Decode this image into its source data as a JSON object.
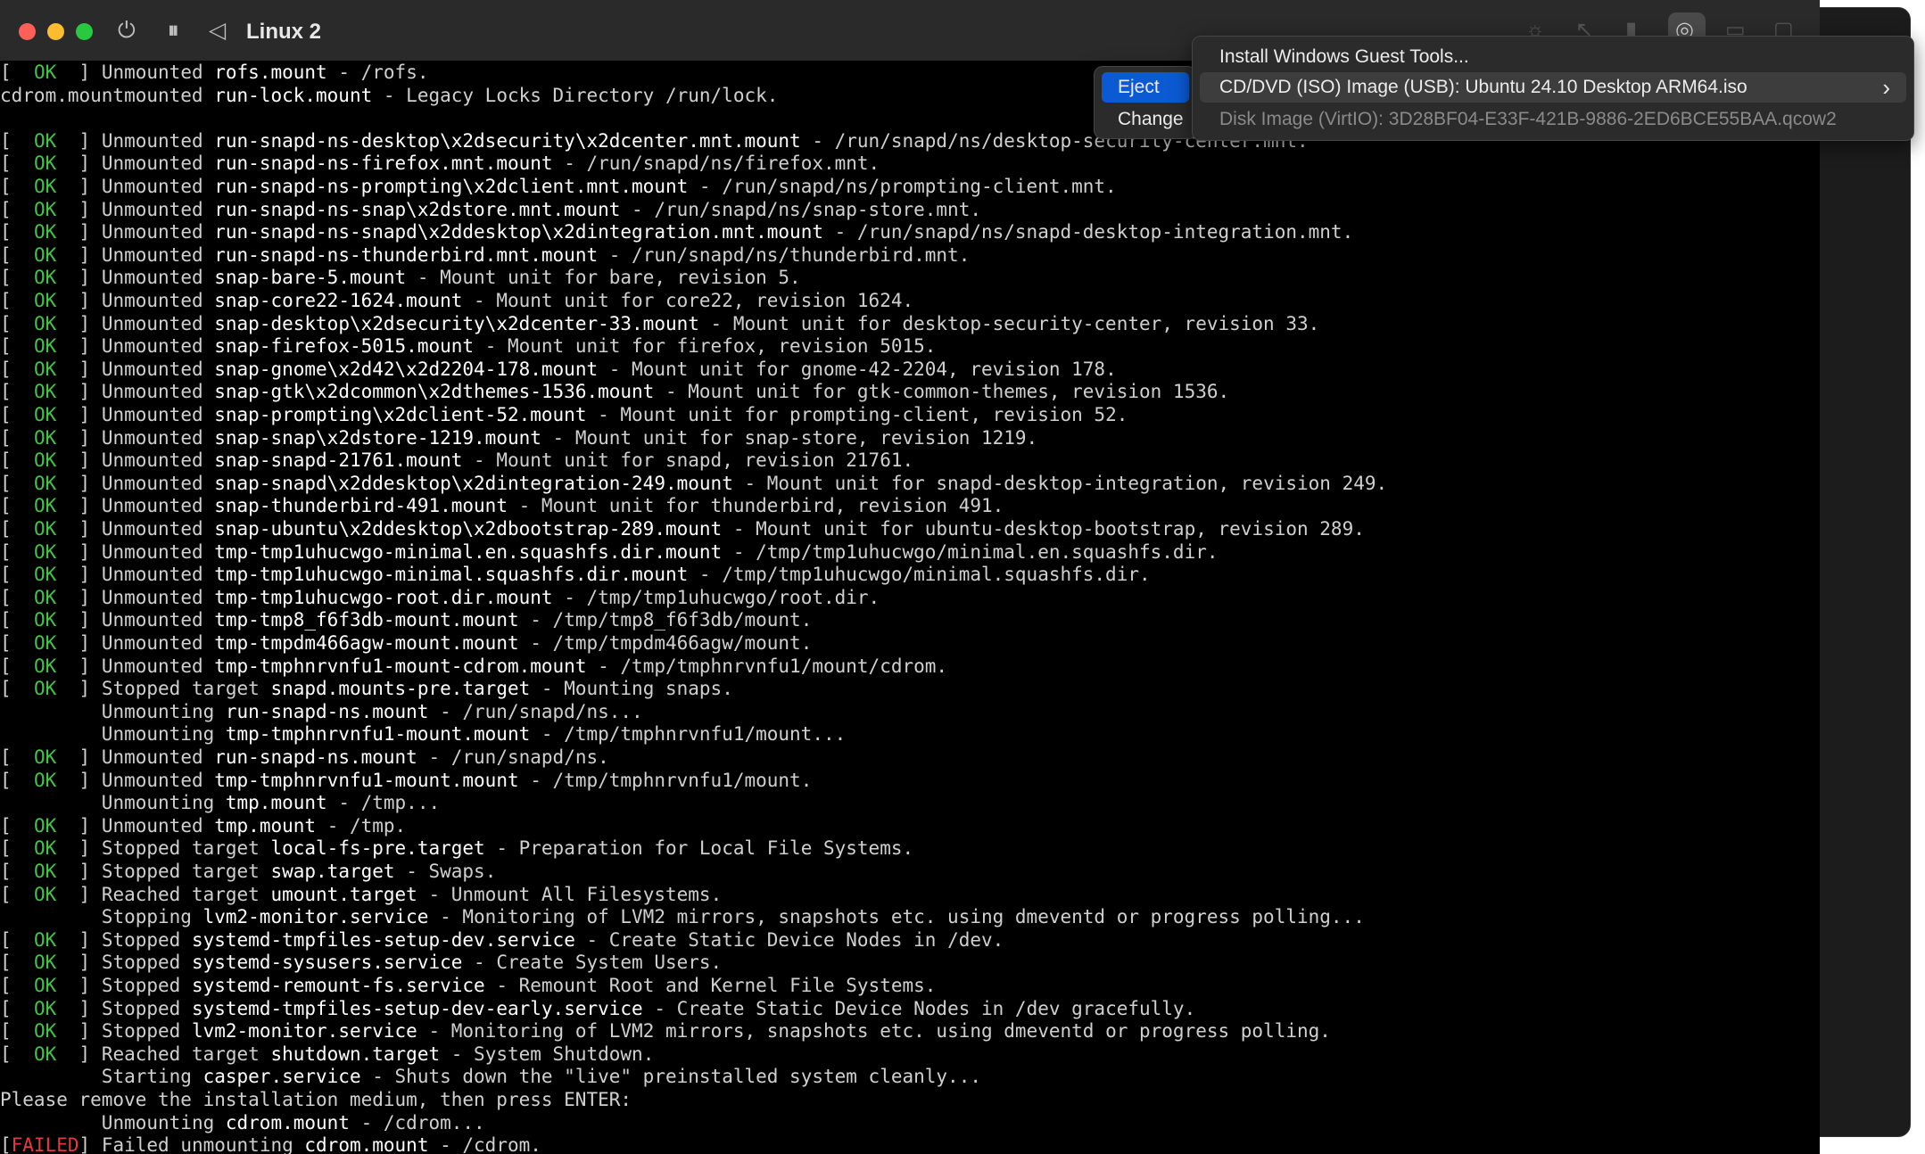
{
  "window": {
    "title": "Linux 2",
    "controls": [
      "power-icon",
      "pause-icon",
      "back-icon"
    ],
    "toolbar_icons": [
      "brightness-icon",
      "cursor-icon",
      "usb-icon",
      "cd-icon",
      "folder-icon",
      "window-icon"
    ]
  },
  "eject_menu": {
    "items": [
      {
        "label": "Eject",
        "selected": true
      },
      {
        "label": "Change",
        "selected": false
      }
    ]
  },
  "device_menu": {
    "items": [
      {
        "label": "Install Windows Guest Tools...",
        "disabled": false
      },
      {
        "label": "CD/DVD (ISO) Image (USB): Ubuntu 24.10 Desktop ARM64.iso",
        "disabled": false,
        "highlighted": true,
        "submenu": true
      },
      {
        "label": "Disk Image (VirtIO): 3D28BF04-E33F-421B-9886-2ED6BCE55BAA.qcow2",
        "disabled": true
      }
    ]
  },
  "terminal": {
    "lines": [
      {
        "status": "OK",
        "verb": "Unmounted",
        "unit": "rofs.mount",
        "desc": " - /rofs."
      },
      {
        "status": "",
        "verb": "cdrom.mountmounted",
        "unit": "run-lock.mount",
        "desc": " - Legacy Locks Directory /run/lock.",
        "raw": true
      },
      {
        "status": "",
        "verb": "",
        "unit": "",
        "desc": "",
        "blank": true
      },
      {
        "status": "OK",
        "verb": "Unmounted",
        "unit": "run-snapd-ns-desktop\\x2dsecurity\\x2dcenter.mnt.mount",
        "desc": " - /run/snapd/ns/desktop-security-center.mnt."
      },
      {
        "status": "OK",
        "verb": "Unmounted",
        "unit": "run-snapd-ns-firefox.mnt.mount",
        "desc": " - /run/snapd/ns/firefox.mnt."
      },
      {
        "status": "OK",
        "verb": "Unmounted",
        "unit": "run-snapd-ns-prompting\\x2dclient.mnt.mount",
        "desc": " - /run/snapd/ns/prompting-client.mnt."
      },
      {
        "status": "OK",
        "verb": "Unmounted",
        "unit": "run-snapd-ns-snap\\x2dstore.mnt.mount",
        "desc": " - /run/snapd/ns/snap-store.mnt."
      },
      {
        "status": "OK",
        "verb": "Unmounted",
        "unit": "run-snapd-ns-snapd\\x2ddesktop\\x2dintegration.mnt.mount",
        "desc": " - /run/snapd/ns/snapd-desktop-integration.mnt."
      },
      {
        "status": "OK",
        "verb": "Unmounted",
        "unit": "run-snapd-ns-thunderbird.mnt.mount",
        "desc": " - /run/snapd/ns/thunderbird.mnt."
      },
      {
        "status": "OK",
        "verb": "Unmounted",
        "unit": "snap-bare-5.mount",
        "desc": " - Mount unit for bare, revision 5."
      },
      {
        "status": "OK",
        "verb": "Unmounted",
        "unit": "snap-core22-1624.mount",
        "desc": " - Mount unit for core22, revision 1624."
      },
      {
        "status": "OK",
        "verb": "Unmounted",
        "unit": "snap-desktop\\x2dsecurity\\x2dcenter-33.mount",
        "desc": " - Mount unit for desktop-security-center, revision 33."
      },
      {
        "status": "OK",
        "verb": "Unmounted",
        "unit": "snap-firefox-5015.mount",
        "desc": " - Mount unit for firefox, revision 5015."
      },
      {
        "status": "OK",
        "verb": "Unmounted",
        "unit": "snap-gnome\\x2d42\\x2d2204-178.mount",
        "desc": " - Mount unit for gnome-42-2204, revision 178."
      },
      {
        "status": "OK",
        "verb": "Unmounted",
        "unit": "snap-gtk\\x2dcommon\\x2dthemes-1536.mount",
        "desc": " - Mount unit for gtk-common-themes, revision 1536."
      },
      {
        "status": "OK",
        "verb": "Unmounted",
        "unit": "snap-prompting\\x2dclient-52.mount",
        "desc": " - Mount unit for prompting-client, revision 52."
      },
      {
        "status": "OK",
        "verb": "Unmounted",
        "unit": "snap-snap\\x2dstore-1219.mount",
        "desc": " - Mount unit for snap-store, revision 1219."
      },
      {
        "status": "OK",
        "verb": "Unmounted",
        "unit": "snap-snapd-21761.mount",
        "desc": " - Mount unit for snapd, revision 21761."
      },
      {
        "status": "OK",
        "verb": "Unmounted",
        "unit": "snap-snapd\\x2ddesktop\\x2dintegration-249.mount",
        "desc": " - Mount unit for snapd-desktop-integration, revision 249."
      },
      {
        "status": "OK",
        "verb": "Unmounted",
        "unit": "snap-thunderbird-491.mount",
        "desc": " - Mount unit for thunderbird, revision 491."
      },
      {
        "status": "OK",
        "verb": "Unmounted",
        "unit": "snap-ubuntu\\x2ddesktop\\x2dbootstrap-289.mount",
        "desc": " - Mount unit for ubuntu-desktop-bootstrap, revision 289."
      },
      {
        "status": "OK",
        "verb": "Unmounted",
        "unit": "tmp-tmp1uhucwgo-minimal.en.squashfs.dir.mount",
        "desc": " - /tmp/tmp1uhucwgo/minimal.en.squashfs.dir."
      },
      {
        "status": "OK",
        "verb": "Unmounted",
        "unit": "tmp-tmp1uhucwgo-minimal.squashfs.dir.mount",
        "desc": " - /tmp/tmp1uhucwgo/minimal.squashfs.dir."
      },
      {
        "status": "OK",
        "verb": "Unmounted",
        "unit": "tmp-tmp1uhucwgo-root.dir.mount",
        "desc": " - /tmp/tmp1uhucwgo/root.dir."
      },
      {
        "status": "OK",
        "verb": "Unmounted",
        "unit": "tmp-tmp8_f6f3db-mount.mount",
        "desc": " - /tmp/tmp8_f6f3db/mount."
      },
      {
        "status": "OK",
        "verb": "Unmounted",
        "unit": "tmp-tmpdm466agw-mount.mount",
        "desc": " - /tmp/tmpdm466agw/mount."
      },
      {
        "status": "OK",
        "verb": "Unmounted",
        "unit": "tmp-tmphnrvnfu1-mount-cdrom.mount",
        "desc": " - /tmp/tmphnrvnfu1/mount/cdrom."
      },
      {
        "status": "OK",
        "verb": "Stopped target",
        "unit": "snapd.mounts-pre.target",
        "desc": " - Mounting snaps."
      },
      {
        "status": "",
        "verb": "Unmounting",
        "unit": "run-snapd-ns.mount",
        "desc": " - /run/snapd/ns..."
      },
      {
        "status": "",
        "verb": "Unmounting",
        "unit": "tmp-tmphnrvnfu1-mount.mount",
        "desc": " - /tmp/tmphnrvnfu1/mount..."
      },
      {
        "status": "OK",
        "verb": "Unmounted",
        "unit": "run-snapd-ns.mount",
        "desc": " - /run/snapd/ns."
      },
      {
        "status": "OK",
        "verb": "Unmounted",
        "unit": "tmp-tmphnrvnfu1-mount.mount",
        "desc": " - /tmp/tmphnrvnfu1/mount."
      },
      {
        "status": "",
        "verb": "Unmounting",
        "unit": "tmp.mount",
        "desc": " - /tmp..."
      },
      {
        "status": "OK",
        "verb": "Unmounted",
        "unit": "tmp.mount",
        "desc": " - /tmp."
      },
      {
        "status": "OK",
        "verb": "Stopped target",
        "unit": "local-fs-pre.target",
        "desc": " - Preparation for Local File Systems."
      },
      {
        "status": "OK",
        "verb": "Stopped target",
        "unit": "swap.target",
        "desc": " - Swaps."
      },
      {
        "status": "OK",
        "verb": "Reached target",
        "unit": "umount.target",
        "desc": " - Unmount All Filesystems."
      },
      {
        "status": "",
        "verb": "Stopping",
        "unit": "lvm2-monitor.service",
        "desc": " - Monitoring of LVM2 mirrors, snapshots etc. using dmeventd or progress polling..."
      },
      {
        "status": "OK",
        "verb": "Stopped",
        "unit": "systemd-tmpfiles-setup-dev.service",
        "desc": " - Create Static Device Nodes in /dev."
      },
      {
        "status": "OK",
        "verb": "Stopped",
        "unit": "systemd-sysusers.service",
        "desc": " - Create System Users."
      },
      {
        "status": "OK",
        "verb": "Stopped",
        "unit": "systemd-remount-fs.service",
        "desc": " - Remount Root and Kernel File Systems."
      },
      {
        "status": "OK",
        "verb": "Stopped",
        "unit": "systemd-tmpfiles-setup-dev-early.service",
        "desc": " - Create Static Device Nodes in /dev gracefully."
      },
      {
        "status": "OK",
        "verb": "Stopped",
        "unit": "lvm2-monitor.service",
        "desc": " - Monitoring of LVM2 mirrors, snapshots etc. using dmeventd or progress polling."
      },
      {
        "status": "OK",
        "verb": "Reached target",
        "unit": "shutdown.target",
        "desc": " - System Shutdown."
      },
      {
        "status": "",
        "verb": "Starting",
        "unit": "casper.service",
        "desc": " - Shuts down the \"live\" preinstalled system cleanly..."
      },
      {
        "status": "",
        "verb": "Please remove the installation medium, then press ENTER:",
        "unit": "",
        "desc": "",
        "raw": true
      },
      {
        "status": "",
        "verb": "Unmounting",
        "unit": "cdrom.mount",
        "desc": " - /cdrom..."
      },
      {
        "status": "FAILED",
        "verb": "Failed unmounting",
        "unit": "cdrom.mount",
        "desc": " - /cdrom."
      }
    ]
  }
}
